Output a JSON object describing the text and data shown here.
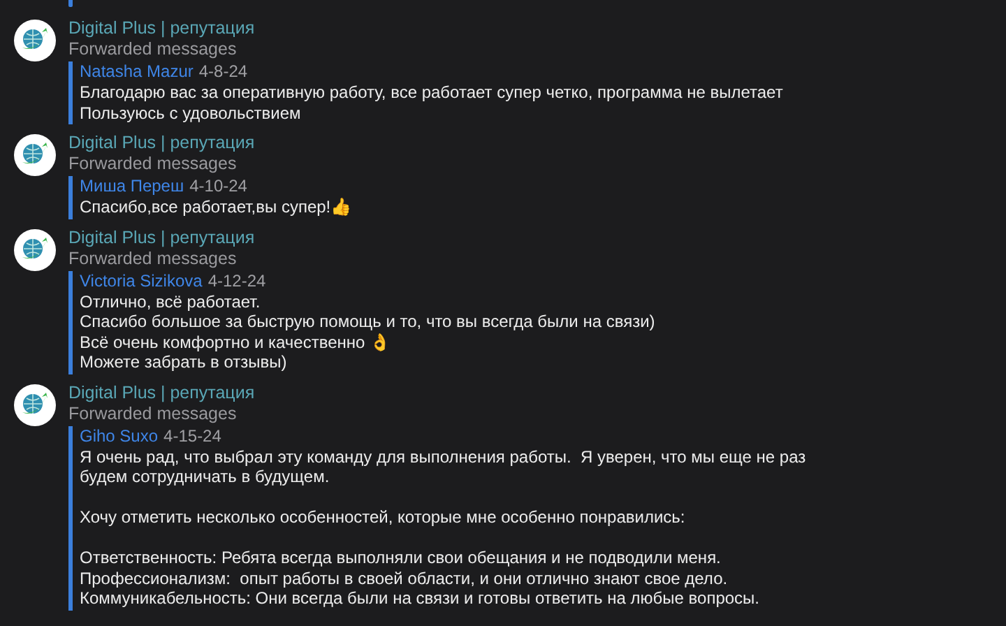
{
  "messages": [
    {
      "sender": "Digital Plus | репутация",
      "subtitle": "Forwarded messages",
      "forwarded": {
        "author": "Natasha Mazur",
        "date": "4-8-24",
        "paragraphs": [
          [
            {
              "text": "Благодарю вас за оперативную работу, все работает супер четко, программа не вылетает"
            },
            {
              "text": "Пользуюсь с удовольствием"
            }
          ]
        ]
      }
    },
    {
      "sender": "Digital Plus | репутация",
      "subtitle": "Forwarded messages",
      "forwarded": {
        "author": "Миша Переш",
        "date": "4-10-24",
        "paragraphs": [
          [
            {
              "text": "Спасибо,все работает,вы супер!👍"
            }
          ]
        ]
      }
    },
    {
      "sender": "Digital Plus | репутация",
      "subtitle": "Forwarded messages",
      "forwarded": {
        "author": "Victoria Sizikova",
        "date": "4-12-24",
        "paragraphs": [
          [
            {
              "text": "Отлично, всё работает."
            },
            {
              "text": "Спасибо большое за быструю помощь и то, что вы всегда были на связи)"
            },
            {
              "text": "Всё очень комфортно и качественно 👌"
            },
            {
              "text": "Можете забрать в отзывы)"
            }
          ]
        ]
      }
    },
    {
      "sender": "Digital Plus | репутация",
      "subtitle": "Forwarded messages",
      "forwarded": {
        "author": "Giho Suxo",
        "date": "4-15-24",
        "paragraphs": [
          [
            {
              "text": "Я очень рад, что выбрал эту команду для выполнения работы.  Я уверен, что мы еще не раз"
            },
            {
              "text": "будем сотрудничать в будущем."
            }
          ],
          [
            {
              "text": "Хочу отметить несколько особенностей, которые мне особенно понравились:"
            }
          ],
          [
            {
              "text": "Ответственность: Ребята всегда выполняли свои обещания и не подводили меня."
            },
            {
              "text": "Профессионализм:  опыт работы в своей области, и они отлично знают свое дело."
            },
            {
              "text": "Коммуникабельность: Они всегда были на связи и готовы ответить на любые вопросы."
            }
          ]
        ]
      }
    }
  ]
}
